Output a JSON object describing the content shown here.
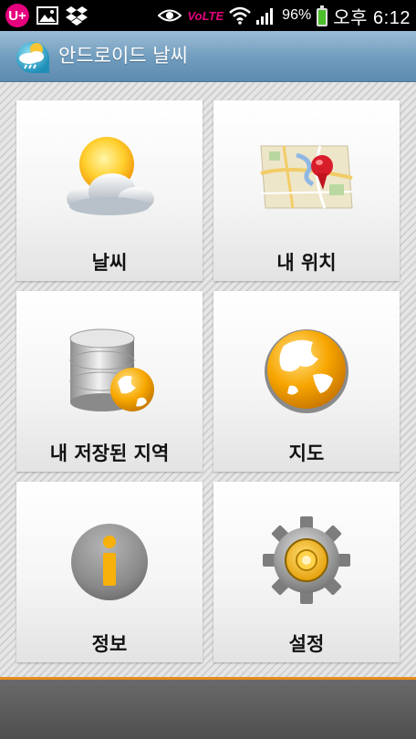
{
  "status_bar": {
    "carrier_badge": "U+",
    "network_label": "VoLTE",
    "battery_percent": "96%",
    "battery_level": 0.96,
    "time": "오후 6:12",
    "icons": [
      "uplus-carrier-icon",
      "gallery-notification-icon",
      "dropbox-notification-icon",
      "smart-stay-eye-icon",
      "volte-icon",
      "wifi-icon",
      "cell-signal-icon",
      "battery-icon"
    ]
  },
  "app": {
    "title": "안드로이드 날씨",
    "accent_color": "#6f9bbd",
    "bottom_line_color": "#e58d1d"
  },
  "tiles": [
    {
      "label": "날씨",
      "icon": "weather-sun-cloud-icon"
    },
    {
      "label": "내 위치",
      "icon": "map-pin-icon"
    },
    {
      "label": "내 저장된 지역",
      "icon": "database-globe-icon"
    },
    {
      "label": "지도",
      "icon": "globe-icon"
    },
    {
      "label": "정보",
      "icon": "info-icon"
    },
    {
      "label": "설정",
      "icon": "settings-gear-icon"
    }
  ]
}
